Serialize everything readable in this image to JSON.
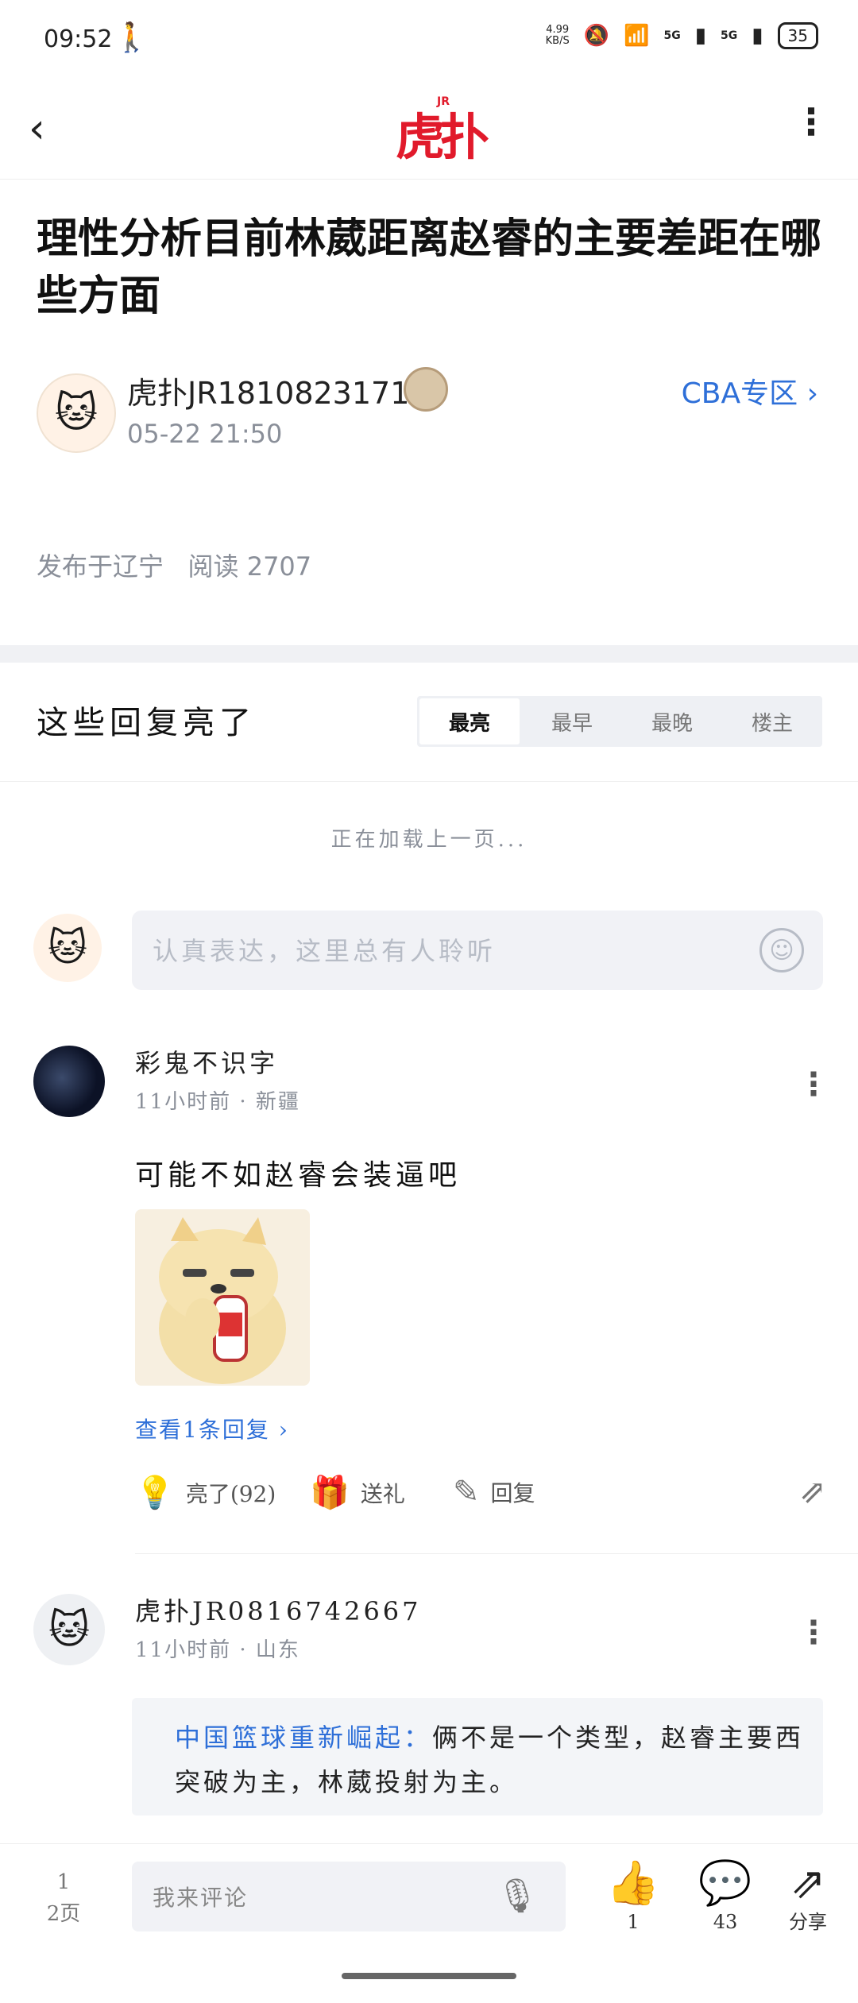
{
  "status_bar": {
    "time": "09:52",
    "netspeed_value": "4.99",
    "netspeed_unit": "KB/S",
    "signal1": "5G",
    "signal2": "5G",
    "battery": "35"
  },
  "header": {
    "logo_text": "虎扑",
    "logo_sup": "JR"
  },
  "post": {
    "title": "理性分析目前林葳距离赵睿的主要差距在哪些方面",
    "author": "虎扑JR1810823171",
    "time": "05-22 21:50",
    "section_link": "CBA专区",
    "location": "发布于辽宁",
    "reads": "阅读 2707"
  },
  "replies": {
    "title": "这些回复亮了",
    "tabs": [
      "最亮",
      "最早",
      "最晚",
      "楼主"
    ],
    "active_tab": "最亮",
    "loading_text": "正在加载上一页...",
    "input_placeholder": "认真表达，这里总有人聆听"
  },
  "comments": [
    {
      "name": "彩鬼不识字",
      "time": "11小时前 · 新疆",
      "text": "可能不如赵睿会装逼吧",
      "view_replies": "查看1条回复",
      "like_label": "亮了(92)",
      "gift_label": "送礼",
      "reply_label": "回复"
    },
    {
      "name": "虎扑JR0816742667",
      "time": "11小时前 · 山东",
      "quote_user": "中国篮球重新崛起：",
      "quote_text": "俩不是一个类型，赵睿主要西突破为主，林葳投射为主。"
    }
  ],
  "bottom_bar": {
    "page_current": "1",
    "page_total": "2页",
    "comment_placeholder": "我来评论",
    "like_count": "1",
    "comment_count": "43",
    "share_label": "分享"
  },
  "colors": {
    "brand_red": "#e11a2b",
    "link_blue": "#2e6fd8",
    "muted": "#8a8f99"
  }
}
